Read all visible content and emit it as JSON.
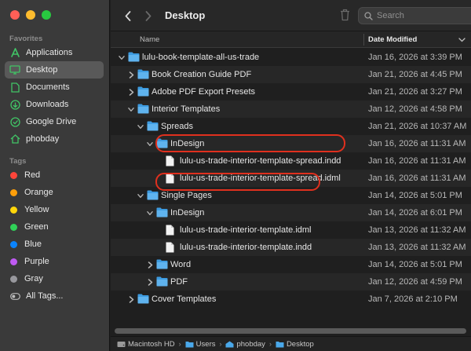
{
  "window": {
    "title": "Desktop"
  },
  "sidebar": {
    "favorites_label": "Favorites",
    "favorites": [
      {
        "label": "Applications",
        "icon": "applications-icon"
      },
      {
        "label": "Desktop",
        "icon": "desktop-icon",
        "active": true
      },
      {
        "label": "Documents",
        "icon": "documents-icon"
      },
      {
        "label": "Downloads",
        "icon": "downloads-icon"
      },
      {
        "label": "Google Drive",
        "icon": "google-drive-icon"
      },
      {
        "label": "phobday",
        "icon": "home-icon"
      }
    ],
    "tags_label": "Tags",
    "tags": [
      {
        "label": "Red",
        "color": "#ff453a"
      },
      {
        "label": "Orange",
        "color": "#ff9f0a"
      },
      {
        "label": "Yellow",
        "color": "#ffd60a"
      },
      {
        "label": "Green",
        "color": "#30d158"
      },
      {
        "label": "Blue",
        "color": "#0a84ff"
      },
      {
        "label": "Purple",
        "color": "#bf5af2"
      },
      {
        "label": "Gray",
        "color": "#98989d"
      }
    ],
    "all_tags_label": "All Tags..."
  },
  "toolbar": {
    "search_placeholder": "Search"
  },
  "columns": {
    "name": "Name",
    "date_modified": "Date Modified"
  },
  "files": [
    {
      "name": "lulu-book-template-all-us-trade",
      "date": "Jan 16, 2026 at 3:39 PM",
      "kind": "folder",
      "expanded": true
    },
    {
      "name": "Book Creation Guide PDF",
      "date": "Jan 21, 2026 at 4:45 PM",
      "kind": "folder",
      "expanded": false
    },
    {
      "name": "Adobe PDF Export Presets",
      "date": "Jan 21, 2026 at 3:27 PM",
      "kind": "folder",
      "expanded": false
    },
    {
      "name": "Interior Templates",
      "date": "Jan 12, 2026 at 4:58 PM",
      "kind": "folder",
      "expanded": true
    },
    {
      "name": "Spreads",
      "date": "Jan 21, 2026 at 10:37 AM",
      "kind": "folder",
      "expanded": true
    },
    {
      "name": "InDesign",
      "date": "Jan 16, 2026 at 11:31 AM",
      "kind": "folder",
      "expanded": true
    },
    {
      "name": "lulu-us-trade-interior-template-spread.indd",
      "date": "Jan 16, 2026 at 11:31 AM",
      "kind": "file"
    },
    {
      "name": "lulu-us-trade-interior-template-spread.idml",
      "date": "Jan 16, 2026 at 11:31 AM",
      "kind": "file",
      "highlighted": true
    },
    {
      "name": "Single Pages",
      "date": "Jan 14, 2026 at 5:01 PM",
      "kind": "folder",
      "expanded": true
    },
    {
      "name": "InDesign",
      "date": "Jan 14, 2026 at 6:01 PM",
      "kind": "folder",
      "expanded": true
    },
    {
      "name": "lulu-us-trade-interior-template.idml",
      "date": "Jan 13, 2026 at 11:32 AM",
      "kind": "file",
      "highlighted": true
    },
    {
      "name": "lulu-us-trade-interior-template.indd",
      "date": "Jan 13, 2026 at 11:32 AM",
      "kind": "file"
    },
    {
      "name": "Word",
      "date": "Jan 14, 2026 at 5:01 PM",
      "kind": "folder",
      "expanded": false
    },
    {
      "name": "PDF",
      "date": "Jan 12, 2026 at 4:59 PM",
      "kind": "folder",
      "expanded": false
    },
    {
      "name": "Cover Templates",
      "date": "Jan 7, 2026 at 2:10 PM",
      "kind": "folder",
      "expanded": false
    }
  ],
  "pathbar": [
    "Macintosh HD",
    "Users",
    "phobday",
    "Desktop"
  ]
}
